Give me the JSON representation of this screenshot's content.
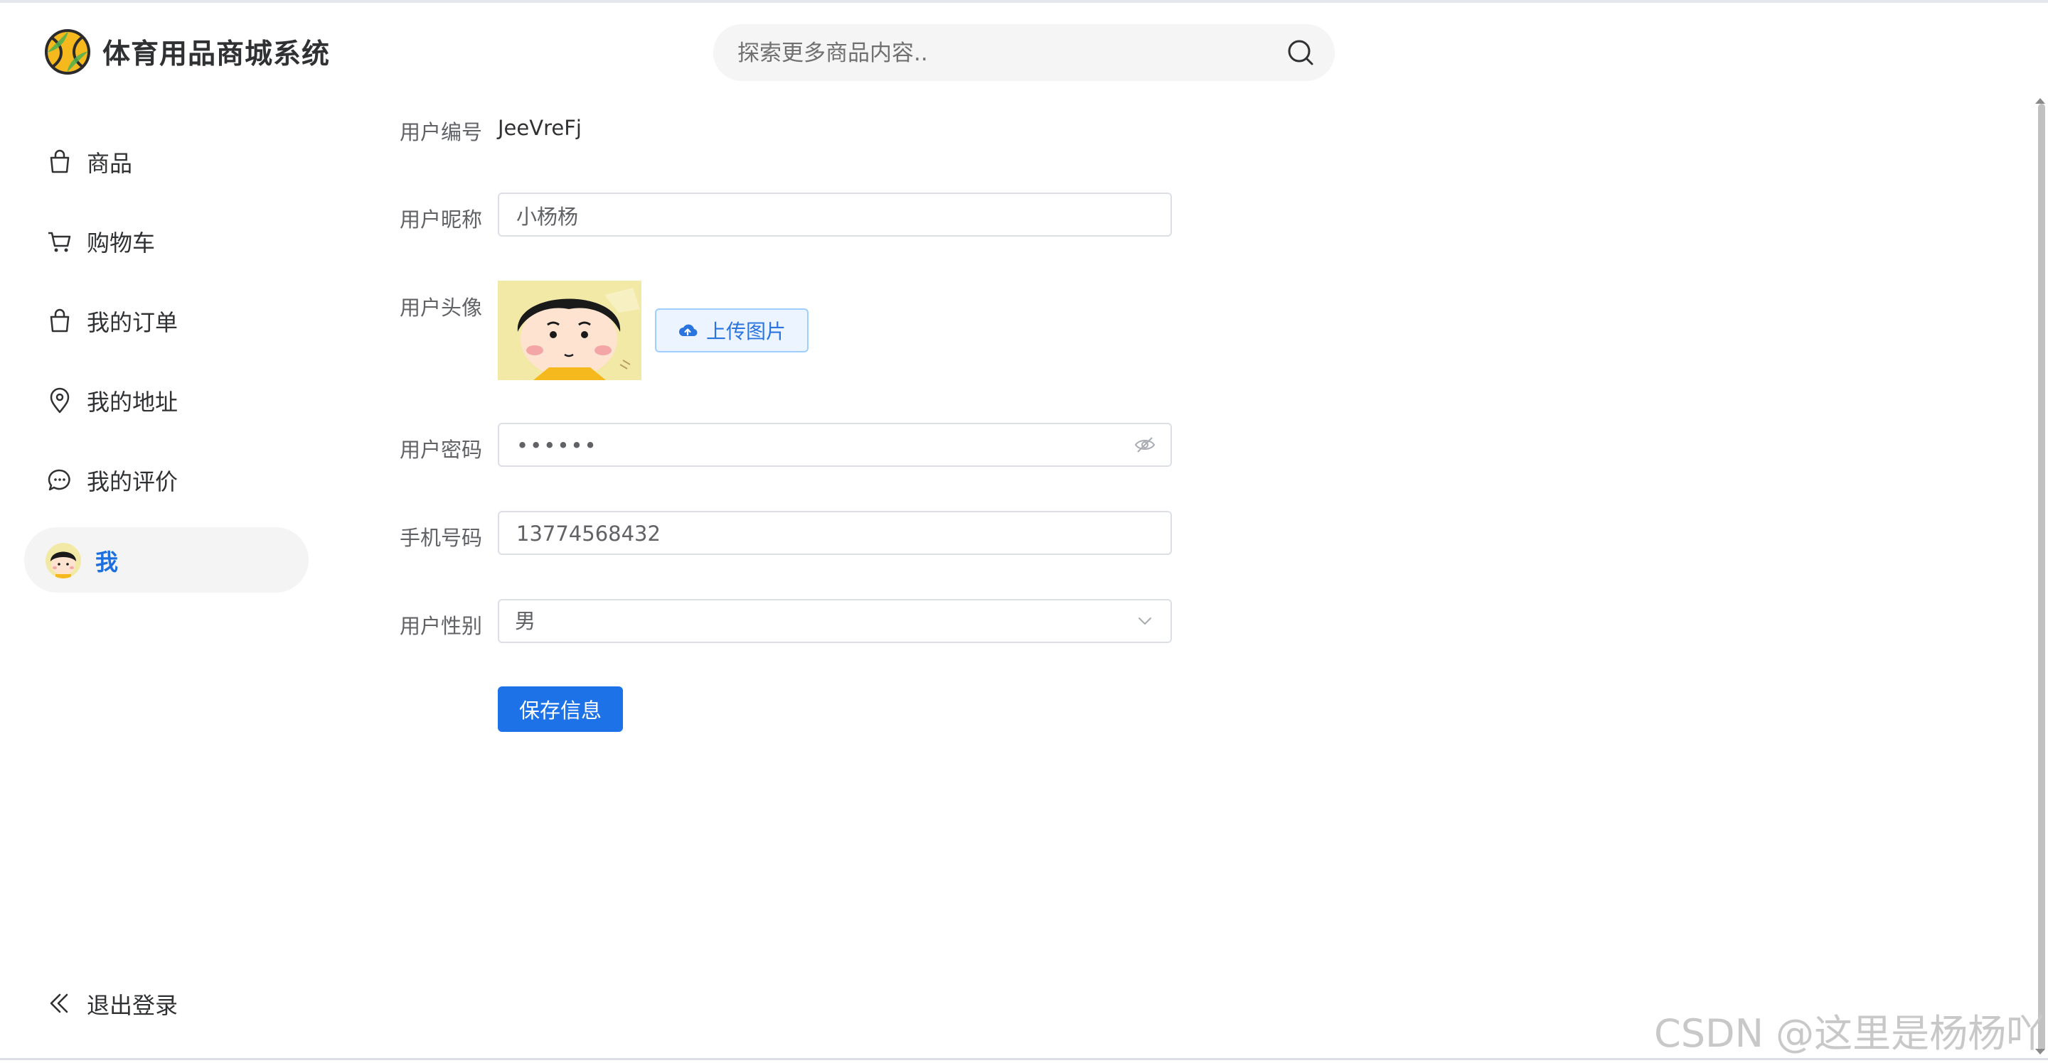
{
  "app": {
    "title": "体育用品商城系统",
    "logo_icon": "tennis-ball-icon"
  },
  "search": {
    "placeholder": "探索更多商品内容.."
  },
  "sidebar": {
    "items": [
      {
        "label": "商品",
        "icon": "bag-icon"
      },
      {
        "label": "购物车",
        "icon": "cart-icon"
      },
      {
        "label": "我的订单",
        "icon": "bag-icon"
      },
      {
        "label": "我的地址",
        "icon": "location-pin-icon"
      },
      {
        "label": "我的评价",
        "icon": "chat-bubble-icon"
      },
      {
        "label": "我",
        "icon": "avatar",
        "active": true
      }
    ],
    "logout": {
      "label": "退出登录",
      "icon": "double-chevron-left-icon"
    }
  },
  "form": {
    "user_id": {
      "label": "用户编号",
      "value": "JeeVreFj"
    },
    "nickname": {
      "label": "用户昵称",
      "value": "小杨杨"
    },
    "avatar": {
      "label": "用户头像",
      "upload_label": "上传图片"
    },
    "password": {
      "label": "用户密码",
      "value": "••••••"
    },
    "phone": {
      "label": "手机号码",
      "value": "13774568432"
    },
    "gender": {
      "label": "用户性别",
      "value": "男"
    },
    "save_label": "保存信息"
  },
  "watermark": "CSDN @这里是杨杨吖",
  "colors": {
    "primary": "#1d72e8",
    "active_text": "#1d6fe0",
    "upload_bg": "#ecf5ff"
  }
}
